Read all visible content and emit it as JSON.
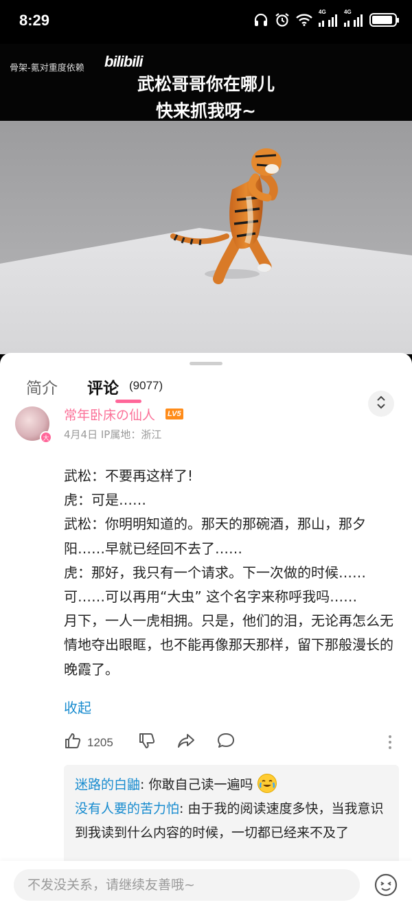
{
  "status_bar": {
    "time": "8:29",
    "network_1": "4G",
    "network_2": "4G"
  },
  "video": {
    "uploader_watermark": "骨架-氪对重度依赖",
    "platform_watermark": "bilibili",
    "subtitle_line1": "武松哥哥你在哪儿",
    "subtitle_line2": "快来抓我呀~"
  },
  "tabs": {
    "intro_label": "简介",
    "comments_label": "评论",
    "comments_count": "(9077)",
    "accent_color": "#ff6699"
  },
  "comment": {
    "username": "常年卧床の仙人",
    "level_badge": "LV5",
    "avatar_badge": "大",
    "meta": "4月4日 IP属地：浙江",
    "body_lines": [
      "武松：不要再这样了!",
      "虎：可是……",
      "武松：你明明知道的。那天的那碗酒，那山，那夕阳……早就已经回不去了……",
      "虎：那好，我只有一个请求。下一次做的时候……可……可以再用“大虫” 这个名字来称呼我吗……",
      "月下，一人一虎相拥。只是，他们的泪，无论再怎么无情地夺出眼眶，也不能再像那天那样，留下那般漫长的晚霞了。"
    ],
    "collapse_label": "收起",
    "like_count": "1205"
  },
  "replies": [
    {
      "name": "迷路的白鼬",
      "text": ": 你敢自己读一遍吗 "
    },
    {
      "name": "没有人要的苦力怕",
      "text": ": 由于我的阅读速度多快，当我意识到我读到什么内容的时候，一切都已经来不及了"
    }
  ],
  "bottom_bar": {
    "placeholder": "不发没关系，请继续友善哦~"
  }
}
